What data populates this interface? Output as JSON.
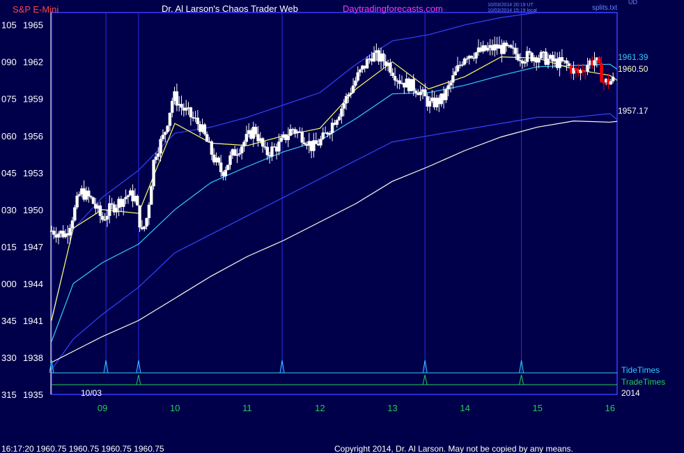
{
  "header": {
    "symbol": "S&P E-Mini",
    "title": "Dr. Al Larson's Chaos Trader Web",
    "site": "Daytradingforecasts.com",
    "ts_utc": "10/03/2014 20:19 UT",
    "ts_local": "10/03/2014 15:19 local",
    "splits_label": "splits.txt",
    "corner_label": "UD"
  },
  "footer": {
    "quote": "16:17:20  1960.75 1960.75 1960.75 1960.75",
    "copyright": "Copyright 2014, Dr. Al Larson. May not be copied by any means."
  },
  "chart_data": {
    "type": "candlestick",
    "ylim": [
      1935,
      1966
    ],
    "price_ticks": [
      1965,
      1962,
      1959,
      1956,
      1953,
      1950,
      1947,
      1944,
      1941,
      1938,
      1935
    ],
    "left_ticks": [
      "105",
      "090",
      "075",
      "060",
      "045",
      "030",
      "015",
      "000",
      "345",
      "330",
      "315"
    ],
    "x_range": [
      8.3,
      16.1
    ],
    "day_ticks": [
      "09",
      "10",
      "11",
      "12",
      "13",
      "14",
      "15",
      "16"
    ],
    "date_label": "10/03",
    "year_label": "2014",
    "tide_label": "TideTimes",
    "trade_label": "TradeTimes",
    "tide_times": [
      8.3,
      9.05,
      9.5,
      11.48,
      13.45,
      14.78
    ],
    "trade_times": [
      9.5,
      13.45,
      14.78
    ],
    "last_values": {
      "cyan": "1961.39",
      "yellow": "1960.50",
      "white": "1957.17"
    },
    "candle_keys": [
      [
        8.3,
        1948.3
      ],
      [
        8.5,
        1948.0
      ],
      [
        8.62,
        1950.0
      ],
      [
        8.7,
        1951.5
      ],
      [
        8.85,
        1950.8
      ],
      [
        9.0,
        1949.2
      ],
      [
        9.1,
        1950.0
      ],
      [
        9.35,
        1951.2
      ],
      [
        9.45,
        1951.0
      ],
      [
        9.55,
        1948.0
      ],
      [
        9.62,
        1949.5
      ],
      [
        9.72,
        1954.5
      ],
      [
        9.85,
        1956.0
      ],
      [
        9.98,
        1959.3
      ],
      [
        10.08,
        1958.4
      ],
      [
        10.35,
        1956.8
      ],
      [
        10.55,
        1954.0
      ],
      [
        10.65,
        1953.0
      ],
      [
        10.8,
        1954.5
      ],
      [
        11.0,
        1955.8
      ],
      [
        11.1,
        1956.6
      ],
      [
        11.25,
        1954.5
      ],
      [
        11.45,
        1955.3
      ],
      [
        11.62,
        1956.6
      ],
      [
        11.8,
        1955.8
      ],
      [
        11.9,
        1955.0
      ],
      [
        12.05,
        1955.8
      ],
      [
        12.3,
        1958.3
      ],
      [
        12.52,
        1960.8
      ],
      [
        12.72,
        1962.6
      ],
      [
        12.92,
        1962.0
      ],
      [
        13.1,
        1960.5
      ],
      [
        13.35,
        1959.8
      ],
      [
        13.52,
        1958.5
      ],
      [
        13.7,
        1959.0
      ],
      [
        13.85,
        1960.8
      ],
      [
        14.0,
        1962.6
      ],
      [
        14.2,
        1962.8
      ],
      [
        14.45,
        1963.2
      ],
      [
        14.65,
        1962.8
      ],
      [
        14.8,
        1962.4
      ],
      [
        15.0,
        1962.5
      ],
      [
        15.22,
        1962.0
      ],
      [
        15.4,
        1961.8
      ],
      [
        15.55,
        1961.0
      ],
      [
        15.7,
        1961.9
      ],
      [
        15.8,
        1962.2
      ],
      [
        15.92,
        1960.3
      ],
      [
        16.05,
        1960.5
      ]
    ],
    "red_bar_from": 15.45,
    "bands": {
      "x": [
        8.3,
        8.6,
        9.0,
        9.5,
        10.0,
        10.5,
        11.0,
        11.5,
        12.0,
        12.5,
        13.0,
        13.5,
        14.0,
        14.5,
        15.0,
        15.5,
        16.0,
        16.1
      ],
      "yellow": [
        1941.0,
        1948.5,
        1950.0,
        1949.7,
        1957.0,
        1955.4,
        1955.2,
        1956.0,
        1956.6,
        1959.8,
        1962.0,
        1959.8,
        1960.8,
        1962.4,
        1962.3,
        1961.4,
        1960.9,
        1960.5
      ],
      "cyan": [
        1939.3,
        1944.0,
        1945.7,
        1947.2,
        1950.0,
        1952.2,
        1953.5,
        1954.7,
        1955.6,
        1957.4,
        1959.4,
        1959.5,
        1960.1,
        1960.9,
        1961.6,
        1961.7,
        1961.8,
        1961.4
      ],
      "blue_upper": [
        1941.2,
        1948.4,
        1951.0,
        1953.2,
        1956.2,
        1956.7,
        1957.5,
        1958.5,
        1959.5,
        1961.8,
        1963.7,
        1964.2,
        1965.0,
        1965.6,
        1966.0,
        1966.0,
        1966.0,
        1966.0
      ],
      "blue_lower": [
        1937.0,
        1939.5,
        1941.5,
        1943.7,
        1946.5,
        1948.0,
        1949.5,
        1951.0,
        1952.5,
        1954.0,
        1955.5,
        1956.0,
        1956.5,
        1957.0,
        1957.5,
        1957.5,
        1957.8,
        1957.3
      ],
      "white": [
        1937.6,
        1938.5,
        1939.7,
        1941.0,
        1942.8,
        1944.6,
        1946.2,
        1947.5,
        1949.0,
        1950.5,
        1952.3,
        1953.5,
        1954.8,
        1955.9,
        1956.7,
        1957.2,
        1957.1,
        1957.17
      ]
    },
    "colors": {
      "background": "#00004a",
      "frame": "#3a3aff",
      "candle_up": "#ffffff",
      "candle_down": "#ff0000",
      "yellow": "#ffff66",
      "cyan": "#33ccff",
      "blue": "#3344ff",
      "white": "#ffffee",
      "tide": "#33ccff",
      "trade": "#22cc55",
      "day_tick_text": "#22cc55",
      "site_text": "#ff33ff",
      "symbol_text": "#ff4444"
    }
  }
}
